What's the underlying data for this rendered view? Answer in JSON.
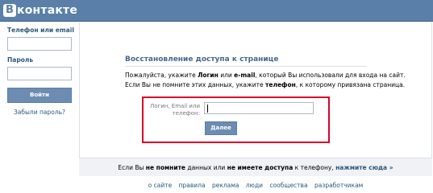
{
  "header": {
    "logo_mark": "В",
    "logo_text": "контакте"
  },
  "sidebar": {
    "phone_label": "Телефон или email",
    "password_label": "Пароль",
    "login_button": "Войти",
    "forgot_link": "Забыли пароль?"
  },
  "main": {
    "title": "Восстановление доступа к странице",
    "desc1_a": "Пожалуйста, укажите ",
    "desc1_b": "Логин",
    "desc1_c": " или ",
    "desc1_d": "e-mail",
    "desc1_e": ", который Вы использовали для входа на сайт.",
    "desc2_a": "Если Вы не помните этих данных, укажите ",
    "desc2_b": "телефон",
    "desc2_c": ", к которому привязана страница.",
    "field_label": "Логин, Email или телефон:",
    "next_button": "Далее"
  },
  "bottom": {
    "text_a": "Если Вы ",
    "text_b": "не помните",
    "text_c": " данных или ",
    "text_d": "не имеете доступа",
    "text_e": " к телефону, ",
    "link": "нажмите сюда »"
  },
  "footer": {
    "links": [
      "о сайте",
      "правила",
      "реклама",
      "люди",
      "сообщества",
      "разработчикам"
    ]
  },
  "colors": {
    "header": "#5a7fa8",
    "link": "#2b587a",
    "highlight": "#d8002a",
    "button": "#6c8cb1"
  }
}
